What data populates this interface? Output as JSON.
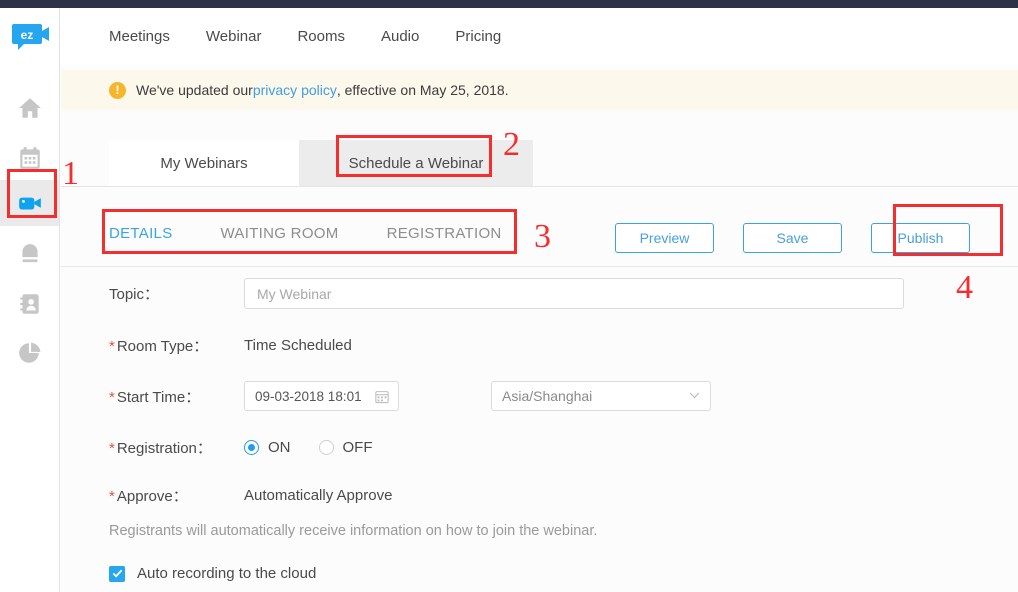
{
  "brand": {
    "logo_text": "ez",
    "accent": "#25a6ef",
    "annotation_color": "#f42e2e"
  },
  "sidebar": {
    "items": [
      {
        "name": "home",
        "icon": "home-icon",
        "active": false
      },
      {
        "name": "calendar",
        "icon": "calendar-icon",
        "active": false
      },
      {
        "name": "webinar",
        "icon": "video-camera-icon",
        "active": true
      },
      {
        "name": "recordings",
        "icon": "recordings-icon",
        "active": false
      },
      {
        "name": "contacts",
        "icon": "address-book-icon",
        "active": false
      },
      {
        "name": "reports",
        "icon": "pie-chart-icon",
        "active": false
      }
    ]
  },
  "topnav": {
    "items": [
      {
        "label": "Meetings"
      },
      {
        "label": "Webinar"
      },
      {
        "label": "Rooms"
      },
      {
        "label": "Audio"
      },
      {
        "label": "Pricing"
      }
    ]
  },
  "banner": {
    "icon": "warning-icon",
    "text_before": "We've updated our ",
    "link": "privacy policy",
    "text_after": ", effective on May 25, 2018."
  },
  "tabs": [
    {
      "label": "My Webinars",
      "active": true
    },
    {
      "label": "Schedule a Webinar",
      "active": false
    }
  ],
  "subtabs": [
    {
      "label": "DETAILS",
      "selected": true
    },
    {
      "label": "WAITING ROOM",
      "selected": false
    },
    {
      "label": "REGISTRATION",
      "selected": false
    }
  ],
  "actions": {
    "preview": "Preview",
    "save": "Save",
    "publish": "Publish"
  },
  "form": {
    "topic": {
      "label": "Topic：",
      "value": "",
      "placeholder": "My Webinar"
    },
    "room_type": {
      "label": "Room Type：",
      "required": true,
      "value": "Time Scheduled"
    },
    "start_time": {
      "label": "Start Time：",
      "required": true,
      "value": "09-03-2018 18:01",
      "timezone": "Asia/Shanghai"
    },
    "registration": {
      "label": "Registration：",
      "required": true,
      "options": [
        {
          "label": "ON",
          "selected": true
        },
        {
          "label": "OFF",
          "selected": false
        }
      ]
    },
    "approve": {
      "label": "Approve：",
      "required": true,
      "value": "Automatically Approve",
      "helper": "Registrants will automatically receive information on how to join the webinar."
    },
    "auto_record": {
      "label": "Auto recording to the cloud",
      "checked": true
    }
  },
  "annotations": [
    {
      "number": "1"
    },
    {
      "number": "2"
    },
    {
      "number": "3"
    },
    {
      "number": "4"
    }
  ]
}
